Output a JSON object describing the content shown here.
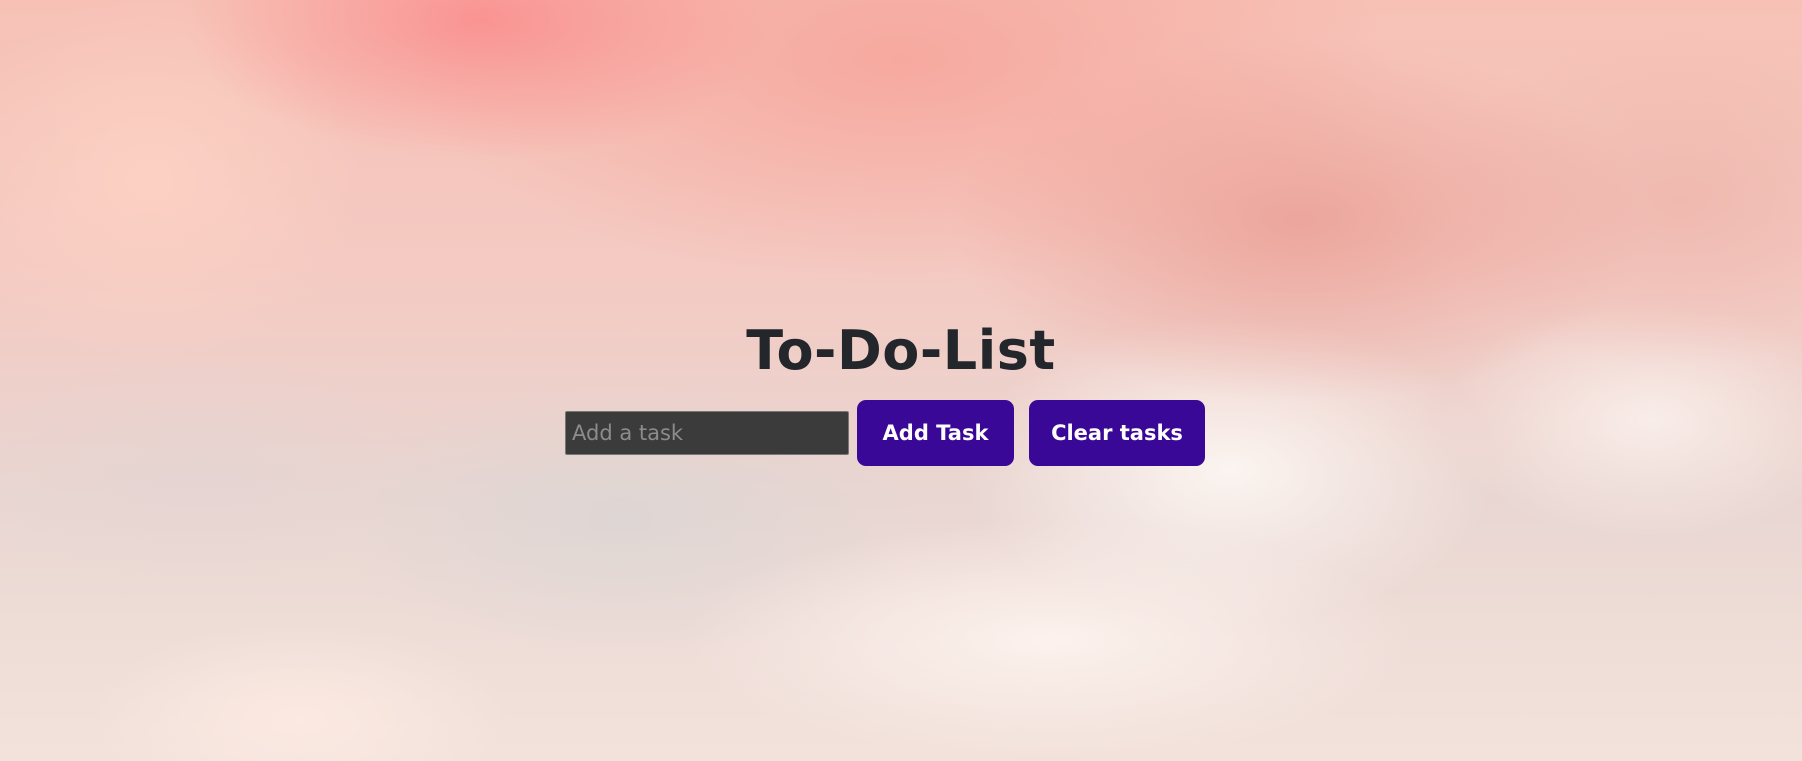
{
  "page": {
    "title": "To-Do-List"
  },
  "form": {
    "input_placeholder": "Add a task",
    "input_value": "",
    "add_button_label": "Add Task",
    "clear_button_label": "Clear tasks"
  },
  "colors": {
    "button_background": "#3a0896",
    "button_text": "#ffffff",
    "input_background": "#3b3b3b",
    "title_text": "#23262b"
  }
}
